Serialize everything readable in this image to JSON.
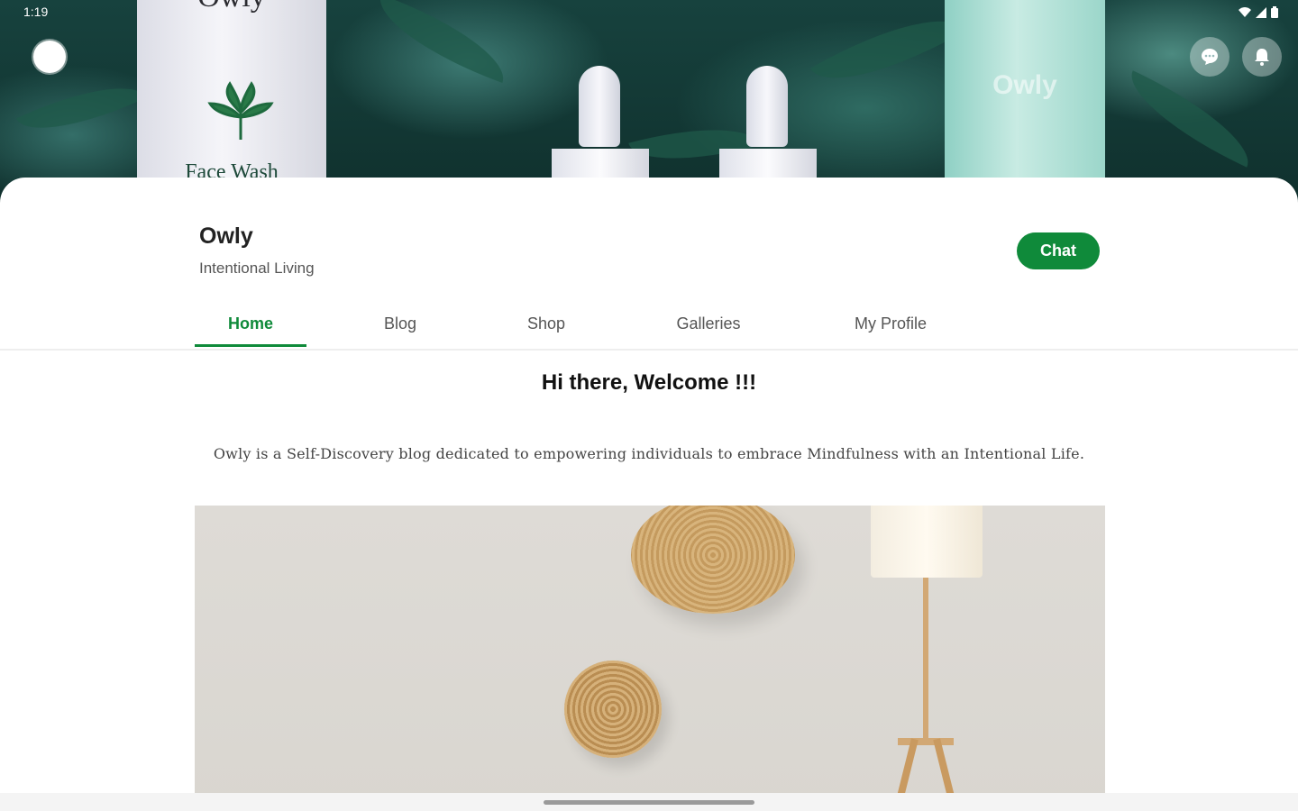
{
  "status_bar": {
    "time": "1:19"
  },
  "cover": {
    "left_product_brand": "Owly",
    "left_product_label": "Face Wash",
    "right_product_brand": "Owly"
  },
  "header": {
    "site_title": "Owly",
    "tagline": "Intentional Living",
    "chat_button": "Chat"
  },
  "tabs": [
    {
      "label": "Home",
      "active": true
    },
    {
      "label": "Blog",
      "active": false
    },
    {
      "label": "Shop",
      "active": false
    },
    {
      "label": "Galleries",
      "active": false
    },
    {
      "label": "My Profile",
      "active": false
    }
  ],
  "content": {
    "welcome": "Hi there, Welcome !!!",
    "intro": "Owly is a Self-Discovery blog dedicated to empowering individuals to embrace Mindfulness with an Intentional Life."
  },
  "colors": {
    "accent": "#0f8a3a"
  },
  "icons": {
    "top_left": "profile-avatar",
    "top_right": [
      "chat-bubble-icon",
      "bell-icon"
    ],
    "status": [
      "wifi-icon",
      "signal-icon",
      "battery-icon"
    ]
  }
}
